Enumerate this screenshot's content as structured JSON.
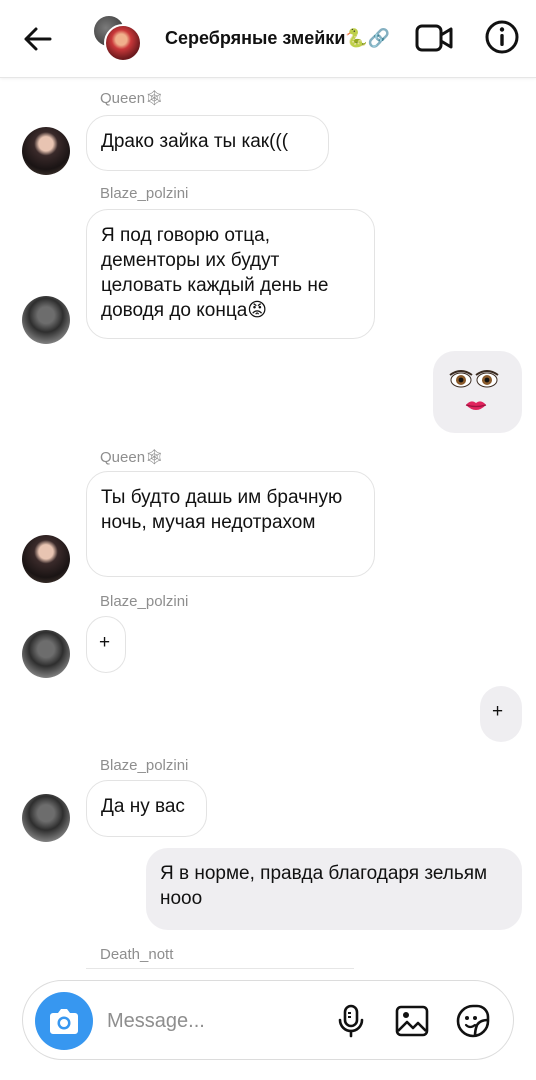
{
  "header": {
    "title": "Серебряные змейки🐍🔗",
    "back_icon": "arrow-left-icon",
    "video_icon": "video-camera-icon",
    "info_icon": "info-icon"
  },
  "messages": [
    {
      "sender": "Queen🕸",
      "text": "Драко зайка ты как((("
    },
    {
      "sender": "Blaze_polzini",
      "text": "Я под говорю отца, дементоры их будут целовать каждый день не доводя до конца😡"
    },
    {
      "self_emoji": "👁👁 👄"
    },
    {
      "sender": "Queen🕸",
      "text": "Ты будто дашь им брачную ночь, мучая недотрахом"
    },
    {
      "sender": "Blaze_polzini",
      "text": "+"
    },
    {
      "self_text": "+"
    },
    {
      "sender": "Blaze_polzini",
      "text": "Да ну вас"
    },
    {
      "self_text": "Я в норме, правда благодаря зельям нооо"
    },
    {
      "sender": "Death_nott"
    }
  ],
  "composer": {
    "placeholder": "Message...",
    "camera_icon": "camera-icon",
    "mic_icon": "microphone-icon",
    "gallery_icon": "image-icon",
    "sticker_icon": "sticker-icon"
  },
  "colors": {
    "accent": "#3797f0",
    "outgoing_bubble": "#efeef1",
    "meta_text": "#8e8e8e"
  }
}
